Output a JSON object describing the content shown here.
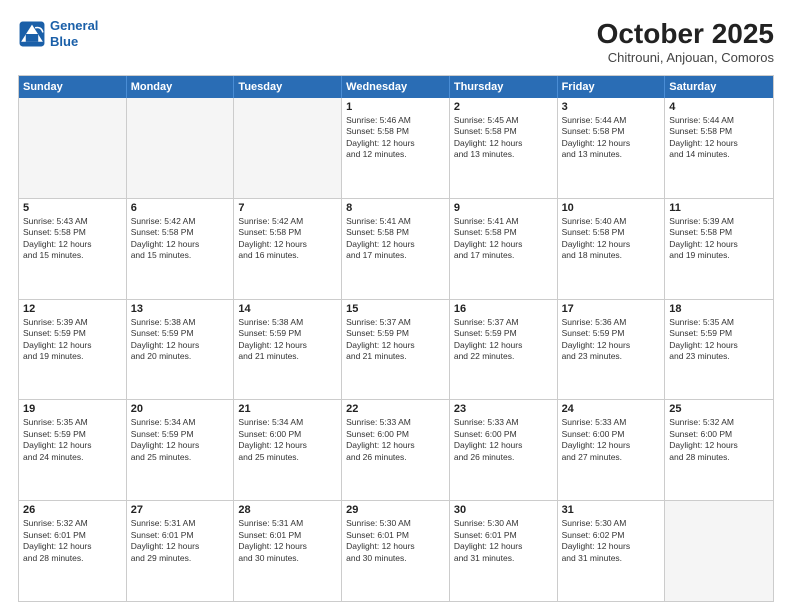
{
  "logo": {
    "line1": "General",
    "line2": "Blue"
  },
  "header": {
    "title": "October 2025",
    "location": "Chitrouni, Anjouan, Comoros"
  },
  "weekdays": [
    "Sunday",
    "Monday",
    "Tuesday",
    "Wednesday",
    "Thursday",
    "Friday",
    "Saturday"
  ],
  "rows": [
    [
      {
        "day": "",
        "empty": true
      },
      {
        "day": "",
        "empty": true
      },
      {
        "day": "",
        "empty": true
      },
      {
        "day": "1",
        "info": "Sunrise: 5:46 AM\nSunset: 5:58 PM\nDaylight: 12 hours\nand 12 minutes."
      },
      {
        "day": "2",
        "info": "Sunrise: 5:45 AM\nSunset: 5:58 PM\nDaylight: 12 hours\nand 13 minutes."
      },
      {
        "day": "3",
        "info": "Sunrise: 5:44 AM\nSunset: 5:58 PM\nDaylight: 12 hours\nand 13 minutes."
      },
      {
        "day": "4",
        "info": "Sunrise: 5:44 AM\nSunset: 5:58 PM\nDaylight: 12 hours\nand 14 minutes."
      }
    ],
    [
      {
        "day": "5",
        "info": "Sunrise: 5:43 AM\nSunset: 5:58 PM\nDaylight: 12 hours\nand 15 minutes."
      },
      {
        "day": "6",
        "info": "Sunrise: 5:42 AM\nSunset: 5:58 PM\nDaylight: 12 hours\nand 15 minutes."
      },
      {
        "day": "7",
        "info": "Sunrise: 5:42 AM\nSunset: 5:58 PM\nDaylight: 12 hours\nand 16 minutes."
      },
      {
        "day": "8",
        "info": "Sunrise: 5:41 AM\nSunset: 5:58 PM\nDaylight: 12 hours\nand 17 minutes."
      },
      {
        "day": "9",
        "info": "Sunrise: 5:41 AM\nSunset: 5:58 PM\nDaylight: 12 hours\nand 17 minutes."
      },
      {
        "day": "10",
        "info": "Sunrise: 5:40 AM\nSunset: 5:58 PM\nDaylight: 12 hours\nand 18 minutes."
      },
      {
        "day": "11",
        "info": "Sunrise: 5:39 AM\nSunset: 5:58 PM\nDaylight: 12 hours\nand 19 minutes."
      }
    ],
    [
      {
        "day": "12",
        "info": "Sunrise: 5:39 AM\nSunset: 5:59 PM\nDaylight: 12 hours\nand 19 minutes."
      },
      {
        "day": "13",
        "info": "Sunrise: 5:38 AM\nSunset: 5:59 PM\nDaylight: 12 hours\nand 20 minutes."
      },
      {
        "day": "14",
        "info": "Sunrise: 5:38 AM\nSunset: 5:59 PM\nDaylight: 12 hours\nand 21 minutes."
      },
      {
        "day": "15",
        "info": "Sunrise: 5:37 AM\nSunset: 5:59 PM\nDaylight: 12 hours\nand 21 minutes."
      },
      {
        "day": "16",
        "info": "Sunrise: 5:37 AM\nSunset: 5:59 PM\nDaylight: 12 hours\nand 22 minutes."
      },
      {
        "day": "17",
        "info": "Sunrise: 5:36 AM\nSunset: 5:59 PM\nDaylight: 12 hours\nand 23 minutes."
      },
      {
        "day": "18",
        "info": "Sunrise: 5:35 AM\nSunset: 5:59 PM\nDaylight: 12 hours\nand 23 minutes."
      }
    ],
    [
      {
        "day": "19",
        "info": "Sunrise: 5:35 AM\nSunset: 5:59 PM\nDaylight: 12 hours\nand 24 minutes."
      },
      {
        "day": "20",
        "info": "Sunrise: 5:34 AM\nSunset: 5:59 PM\nDaylight: 12 hours\nand 25 minutes."
      },
      {
        "day": "21",
        "info": "Sunrise: 5:34 AM\nSunset: 6:00 PM\nDaylight: 12 hours\nand 25 minutes."
      },
      {
        "day": "22",
        "info": "Sunrise: 5:33 AM\nSunset: 6:00 PM\nDaylight: 12 hours\nand 26 minutes."
      },
      {
        "day": "23",
        "info": "Sunrise: 5:33 AM\nSunset: 6:00 PM\nDaylight: 12 hours\nand 26 minutes."
      },
      {
        "day": "24",
        "info": "Sunrise: 5:33 AM\nSunset: 6:00 PM\nDaylight: 12 hours\nand 27 minutes."
      },
      {
        "day": "25",
        "info": "Sunrise: 5:32 AM\nSunset: 6:00 PM\nDaylight: 12 hours\nand 28 minutes."
      }
    ],
    [
      {
        "day": "26",
        "info": "Sunrise: 5:32 AM\nSunset: 6:01 PM\nDaylight: 12 hours\nand 28 minutes."
      },
      {
        "day": "27",
        "info": "Sunrise: 5:31 AM\nSunset: 6:01 PM\nDaylight: 12 hours\nand 29 minutes."
      },
      {
        "day": "28",
        "info": "Sunrise: 5:31 AM\nSunset: 6:01 PM\nDaylight: 12 hours\nand 30 minutes."
      },
      {
        "day": "29",
        "info": "Sunrise: 5:30 AM\nSunset: 6:01 PM\nDaylight: 12 hours\nand 30 minutes."
      },
      {
        "day": "30",
        "info": "Sunrise: 5:30 AM\nSunset: 6:01 PM\nDaylight: 12 hours\nand 31 minutes."
      },
      {
        "day": "31",
        "info": "Sunrise: 5:30 AM\nSunset: 6:02 PM\nDaylight: 12 hours\nand 31 minutes."
      },
      {
        "day": "",
        "empty": true
      }
    ]
  ]
}
